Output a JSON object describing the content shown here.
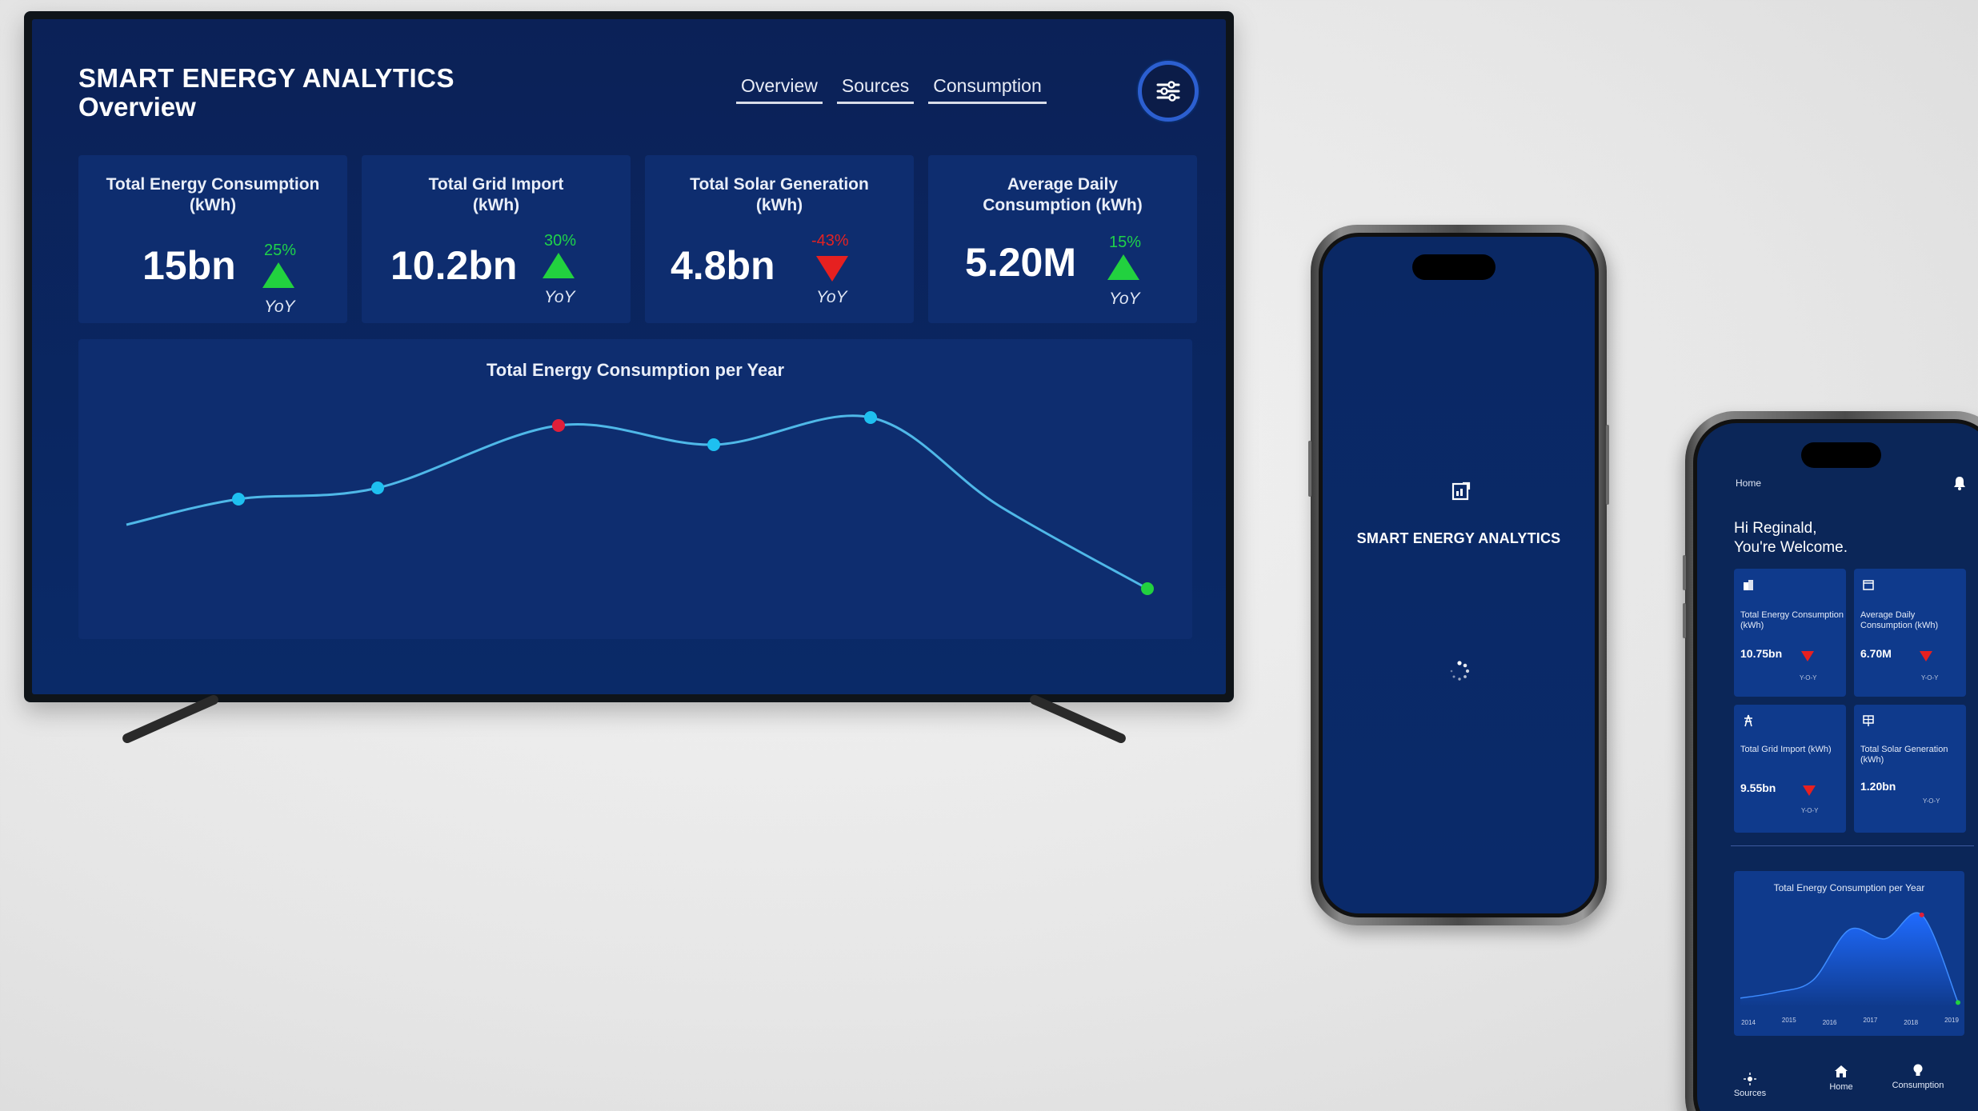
{
  "tv": {
    "title": "SMART ENERGY ANALYTICS",
    "subtitle": "Overview",
    "nav": [
      "Overview",
      "Sources",
      "Consumption"
    ],
    "filter_icon": "sliders-icon",
    "kpis": [
      {
        "label_line1": "Total Energy Consumption",
        "label_line2": "(kWh)",
        "value": "15bn",
        "change": "25%",
        "direction": "up",
        "yoy": "YoY"
      },
      {
        "label_line1": "Total Grid Import",
        "label_line2": "(kWh)",
        "value": "10.2bn",
        "change": "30%",
        "direction": "up",
        "yoy": "YoY"
      },
      {
        "label_line1": "Total Solar Generation",
        "label_line2": "(kWh)",
        "value": "4.8bn",
        "change": "-43%",
        "direction": "down",
        "yoy": "YoY"
      },
      {
        "label_line1": "Average Daily",
        "label_line2": "Consumption (kWh)",
        "value": "5.20M",
        "change": "15%",
        "direction": "up",
        "yoy": "YoY"
      }
    ],
    "chart_title": "Total Energy Consumption per Year"
  },
  "phone1": {
    "title": "SMART ENERGY ANALYTICS",
    "logo_icon": "chart-logo-icon",
    "spinner_icon": "loading-spinner-icon"
  },
  "phone2": {
    "header": "Home",
    "greeting_line1": "Hi Reginald,",
    "greeting_line2": "You're Welcome.",
    "cards": [
      {
        "label": "Total Energy Consumption (kWh)",
        "value": "10.75bn",
        "yoy": "Y-O-Y",
        "icon": "building-icon"
      },
      {
        "label": "Average Daily Consumption (kWh)",
        "value": "6.70M",
        "yoy": "Y-O-Y",
        "icon": "calendar-icon"
      },
      {
        "label": "Total Grid Import (kWh)",
        "value": "9.55bn",
        "yoy": "Y-O-Y",
        "icon": "power-tower-icon"
      },
      {
        "label": "Total Solar Generation (kWh)",
        "value": "1.20bn",
        "yoy": "Y-O-Y",
        "icon": "solar-panel-icon"
      }
    ],
    "chart_title": "Total Energy Consumption per Year",
    "tabs": [
      {
        "label": "Sources",
        "icon": "sun-icon"
      },
      {
        "label": "Home",
        "icon": "home-icon"
      },
      {
        "label": "Consumption",
        "icon": "bulb-icon"
      }
    ]
  },
  "colors": {
    "up": "#22d13f",
    "down": "#e62020",
    "panel": "#0e2d6f",
    "line": "#4fb8e8",
    "point": "#1ec0f0",
    "peak": "#e01f3a",
    "last": "#22d13f"
  },
  "chart_data": [
    {
      "type": "line",
      "title": "Total Energy Consumption per Year",
      "xlabel": "",
      "ylabel": "",
      "x": [
        0,
        1,
        2,
        3,
        4,
        5,
        6,
        7
      ],
      "series": [
        {
          "values": [
            2.2,
            3.0,
            3.35,
            5.3,
            4.7,
            5.55,
            2.8,
            0.2
          ]
        }
      ],
      "point_colors": [
        "none",
        "#1ec0f0",
        "#1ec0f0",
        "#e01f3a",
        "#1ec0f0",
        "#1ec0f0",
        "none",
        "#22d13f"
      ],
      "ylim": [
        0,
        6
      ],
      "grid": false
    },
    {
      "type": "area",
      "title": "Total Energy Consumption per Year",
      "categories": [
        "2014",
        "2015",
        "2016",
        "2017",
        "2018",
        "2019"
      ],
      "values": [
        0.6,
        1.0,
        1.8,
        5.2,
        4.6,
        6.2,
        0.3
      ],
      "ylim": [
        0,
        7
      ],
      "grid": false
    }
  ]
}
